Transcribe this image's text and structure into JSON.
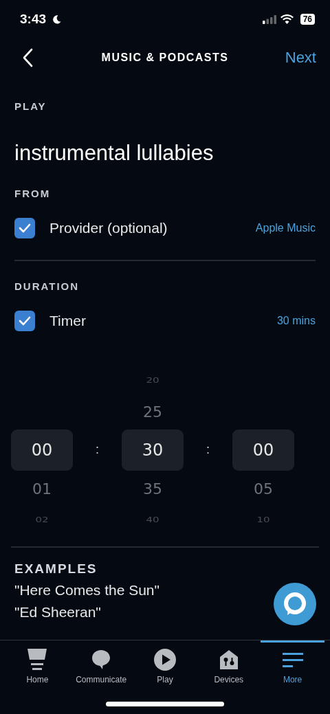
{
  "status_bar": {
    "time": "3:43",
    "battery": "76"
  },
  "header": {
    "title": "MUSIC & PODCASTS",
    "action": "Next"
  },
  "play": {
    "label": "PLAY",
    "query": "instrumental lullabies"
  },
  "from": {
    "label": "FROM",
    "option": {
      "label": "Provider (optional)",
      "checked": true,
      "value": "Apple Music"
    }
  },
  "duration": {
    "label": "DURATION",
    "option": {
      "label": "Timer",
      "checked": true,
      "value": "30 mins"
    }
  },
  "picker": {
    "columns": [
      {
        "items": [
          {
            "label": "00",
            "selected": true
          },
          {
            "label": "01",
            "selected": false
          },
          {
            "label": "02",
            "selected": false
          }
        ]
      },
      {
        "items": [
          {
            "label": "20",
            "selected": false
          },
          {
            "label": "25",
            "selected": false
          },
          {
            "label": "30",
            "selected": true
          },
          {
            "label": "35",
            "selected": false
          },
          {
            "label": "40",
            "selected": false
          }
        ]
      },
      {
        "items": [
          {
            "label": "00",
            "selected": true
          },
          {
            "label": "05",
            "selected": false
          },
          {
            "label": "10",
            "selected": false
          }
        ]
      }
    ],
    "separators": [
      ":",
      ":"
    ]
  },
  "examples": {
    "label": "EXAMPLES",
    "items": [
      "\"Here Comes the Sun\"",
      "\"Ed Sheeran\""
    ]
  },
  "tab_bar": [
    {
      "label": "Home",
      "kind": "home",
      "selected": false
    },
    {
      "label": "Communicate",
      "kind": "communicate",
      "selected": false
    },
    {
      "label": "Play",
      "kind": "play",
      "selected": false
    },
    {
      "label": "Devices",
      "kind": "devices",
      "selected": false
    },
    {
      "label": "More",
      "kind": "more",
      "selected": true
    }
  ]
}
